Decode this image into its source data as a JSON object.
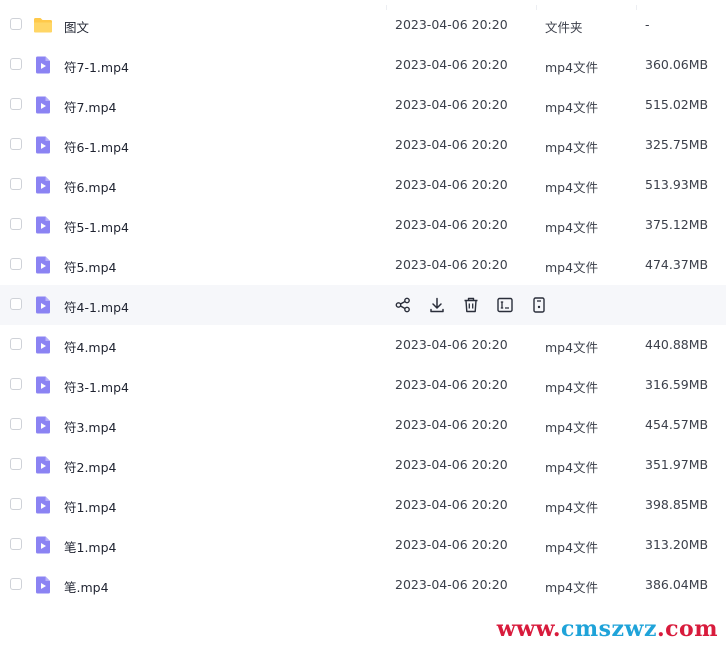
{
  "files": [
    {
      "name": "图文",
      "time": "2023-04-06 20:20",
      "type": "文件夹",
      "size": "-",
      "icon": "folder-icon"
    },
    {
      "name": "符7-1.mp4",
      "time": "2023-04-06 20:20",
      "type": "mp4文件",
      "size": "360.06MB",
      "icon": "video-file-icon"
    },
    {
      "name": "符7.mp4",
      "time": "2023-04-06 20:20",
      "type": "mp4文件",
      "size": "515.02MB",
      "icon": "video-file-icon"
    },
    {
      "name": "符6-1.mp4",
      "time": "2023-04-06 20:20",
      "type": "mp4文件",
      "size": "325.75MB",
      "icon": "video-file-icon"
    },
    {
      "name": "符6.mp4",
      "time": "2023-04-06 20:20",
      "type": "mp4文件",
      "size": "513.93MB",
      "icon": "video-file-icon"
    },
    {
      "name": "符5-1.mp4",
      "time": "2023-04-06 20:20",
      "type": "mp4文件",
      "size": "375.12MB",
      "icon": "video-file-icon"
    },
    {
      "name": "符5.mp4",
      "time": "2023-04-06 20:20",
      "type": "mp4文件",
      "size": "474.37MB",
      "icon": "video-file-icon"
    },
    {
      "name": "符4-1.mp4",
      "time": "",
      "type": "",
      "size": "",
      "icon": "video-file-icon",
      "hovered": true
    },
    {
      "name": "符4.mp4",
      "time": "2023-04-06 20:20",
      "type": "mp4文件",
      "size": "440.88MB",
      "icon": "video-file-icon"
    },
    {
      "name": "符3-1.mp4",
      "time": "2023-04-06 20:20",
      "type": "mp4文件",
      "size": "316.59MB",
      "icon": "video-file-icon"
    },
    {
      "name": "符3.mp4",
      "time": "2023-04-06 20:20",
      "type": "mp4文件",
      "size": "454.57MB",
      "icon": "video-file-icon"
    },
    {
      "name": "符2.mp4",
      "time": "2023-04-06 20:20",
      "type": "mp4文件",
      "size": "351.97MB",
      "icon": "video-file-icon"
    },
    {
      "name": "符1.mp4",
      "time": "2023-04-06 20:20",
      "type": "mp4文件",
      "size": "398.85MB",
      "icon": "video-file-icon"
    },
    {
      "name": "笔1.mp4",
      "time": "2023-04-06 20:20",
      "type": "mp4文件",
      "size": "313.20MB",
      "icon": "video-file-icon"
    },
    {
      "name": "笔.mp4",
      "time": "2023-04-06 20:20",
      "type": "mp4文件",
      "size": "386.04MB",
      "icon": "video-file-icon"
    }
  ],
  "hover_actions": [
    "share-icon",
    "download-icon",
    "delete-icon",
    "rename-icon",
    "more-icon"
  ],
  "colors": {
    "folder": "#ffc94a",
    "video": "#8b83f3",
    "hover_row": "#f6f7fa"
  },
  "watermark": {
    "part1": "www.",
    "part2": "cmszwz",
    "part3": ".com"
  }
}
